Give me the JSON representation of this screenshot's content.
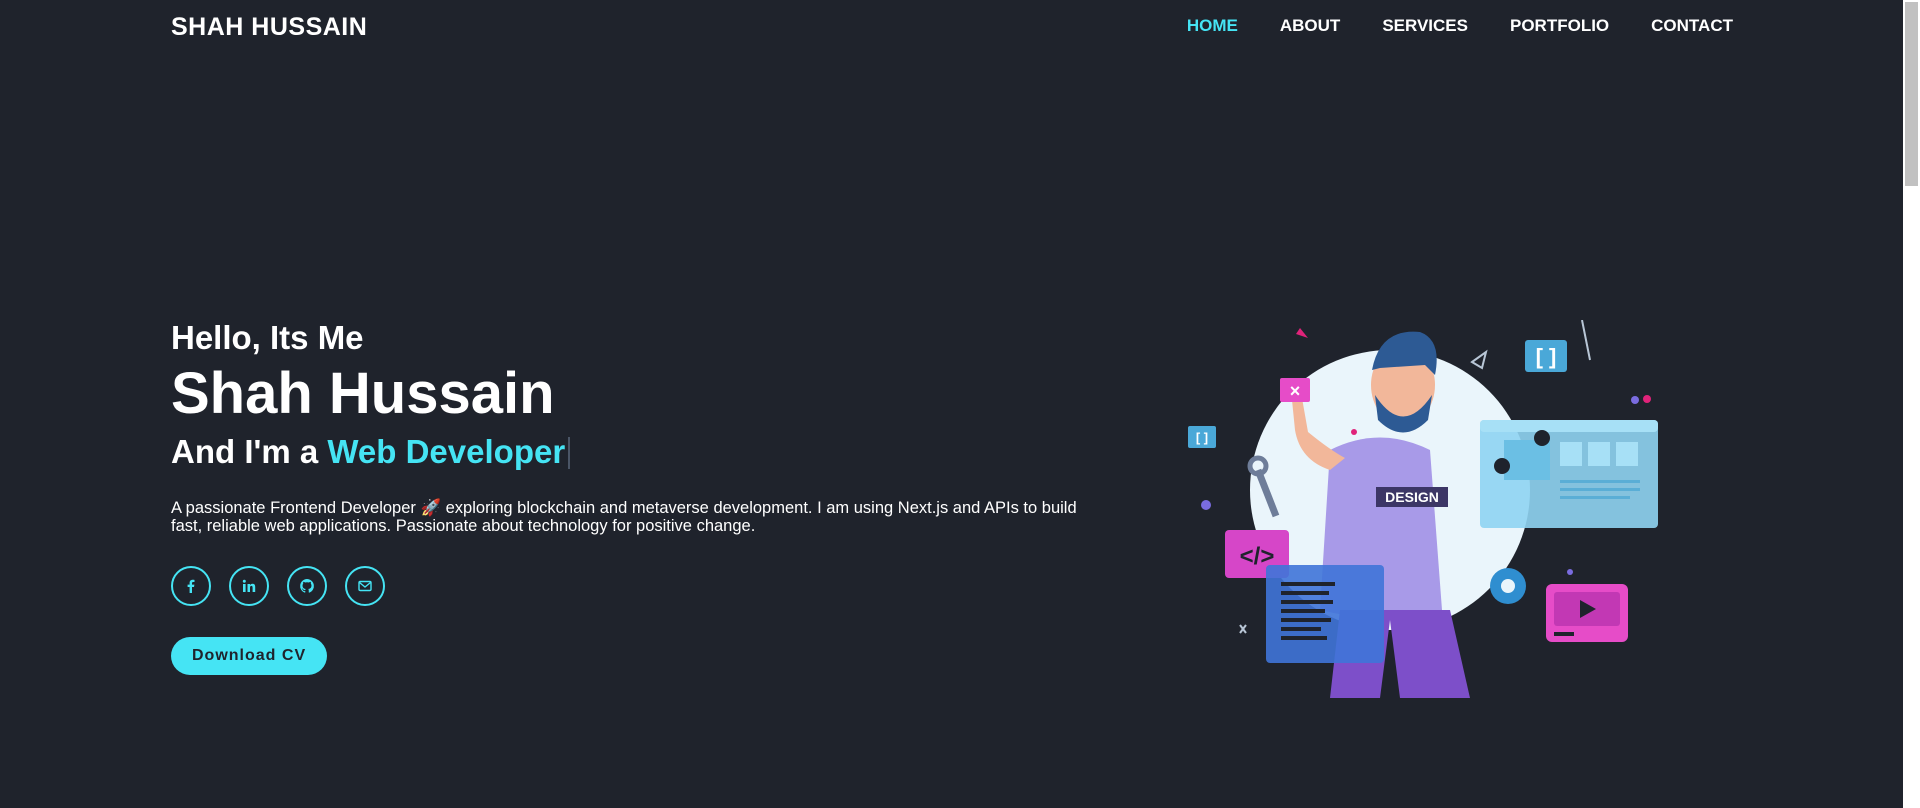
{
  "brand": {
    "name": "SHAH HUSSAIN"
  },
  "nav": {
    "items": [
      {
        "label": "HOME",
        "active": true
      },
      {
        "label": "ABOUT",
        "active": false
      },
      {
        "label": "SERVICES",
        "active": false
      },
      {
        "label": "PORTFOLIO",
        "active": false
      },
      {
        "label": "CONTACT",
        "active": false
      }
    ]
  },
  "hero": {
    "greeting": "Hello, Its Me",
    "name": "Shah Hussain",
    "role_prefix": "And I'm a",
    "role_highlight": "Web Developer",
    "description": "A passionate Frontend Developer 🚀 exploring blockchain and metaverse development. I am using Next.js and APIs to build fast, reliable web applications. Passionate about technology for positive change.",
    "socials": [
      "facebook-icon",
      "linkedin-icon",
      "github-icon",
      "mail-icon"
    ],
    "cta_label": "Download CV",
    "illustration_badge": "DESIGN"
  },
  "colors": {
    "accent": "#45e4f4",
    "background": "#1f232c",
    "text": "#ffffff"
  }
}
